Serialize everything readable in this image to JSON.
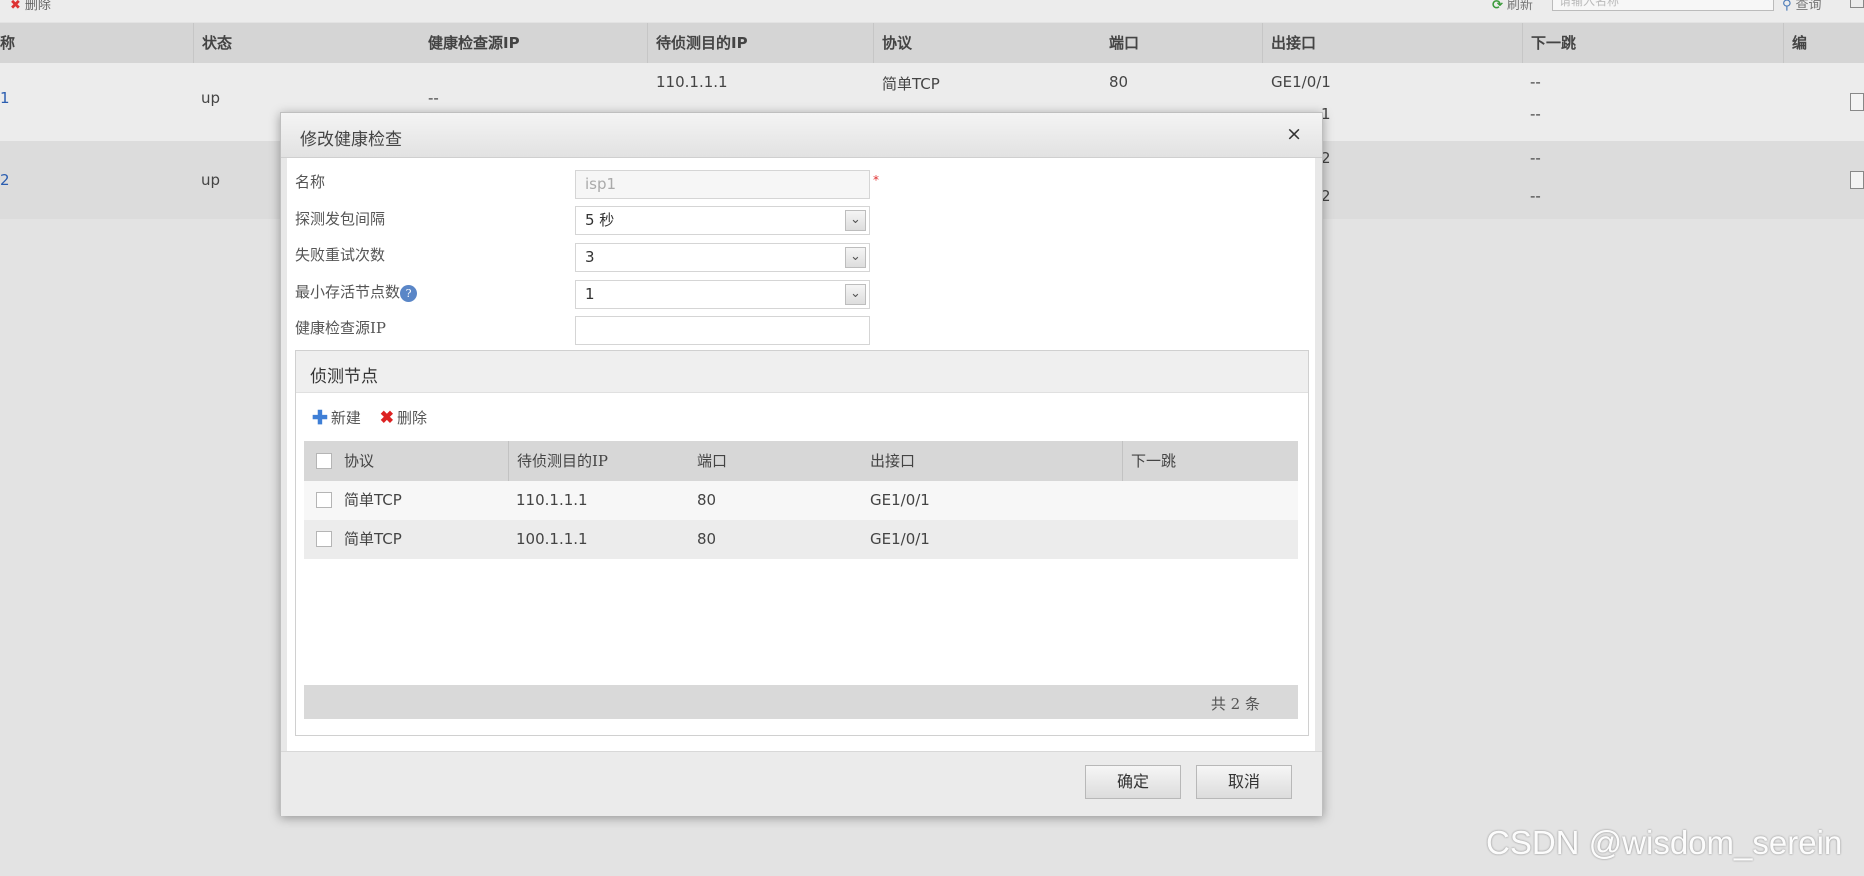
{
  "toolbar": {
    "delete_label": "删除",
    "refresh_label": "刷新",
    "search_placeholder": "请输入名称",
    "query_label": "查询"
  },
  "table": {
    "columns": [
      "称",
      "状态",
      "健康检查源IP",
      "待侦测目的IP",
      "协议",
      "端口",
      "出接口",
      "下一跳",
      "编"
    ],
    "rows": [
      {
        "name": "1",
        "status": "up",
        "source_ip": "--",
        "targets": [
          {
            "dest_ip": "110.1.1.1",
            "protocol": "简单TCP",
            "port": "80",
            "egress": "GE1/0/1",
            "next_hop": "--"
          },
          {
            "dest_ip": "",
            "protocol": "",
            "port": "",
            "egress": "1",
            "next_hop": "--"
          }
        ]
      },
      {
        "name": "2",
        "status": "up",
        "source_ip": "",
        "targets": [
          {
            "dest_ip": "",
            "protocol": "",
            "port": "",
            "egress": "2",
            "next_hop": "--"
          },
          {
            "dest_ip": "",
            "protocol": "",
            "port": "",
            "egress": "2",
            "next_hop": "--"
          }
        ]
      }
    ]
  },
  "dialog": {
    "title": "修改健康检查",
    "close_glyph": "×",
    "fields": {
      "name": {
        "label": "名称",
        "value": "isp1",
        "required_mark": "*"
      },
      "interval": {
        "label": "探测发包间隔",
        "value": "5 秒"
      },
      "retries": {
        "label": "失败重试次数",
        "value": "3"
      },
      "min_alive": {
        "label": "最小存活节点数",
        "value": "1",
        "help_glyph": "?"
      },
      "source_ip": {
        "label": "健康检查源IP",
        "value": ""
      }
    },
    "nodes_panel": {
      "title": "侦测节点",
      "new_label": "新建",
      "delete_label": "删除",
      "columns": [
        "协议",
        "待侦测目的IP",
        "端口",
        "出接口",
        "下一跳"
      ],
      "rows": [
        {
          "protocol": "简单TCP",
          "dest_ip": "110.1.1.1",
          "port": "80",
          "egress": "GE1/0/1",
          "next_hop": ""
        },
        {
          "protocol": "简单TCP",
          "dest_ip": "100.1.1.1",
          "port": "80",
          "egress": "GE1/0/1",
          "next_hop": ""
        }
      ],
      "total_label": "共 2 条"
    },
    "ok_label": "确定",
    "cancel_label": "取消"
  },
  "watermark": "CSDN @wisdom_serein",
  "colors": {
    "link": "#2a5db0",
    "required": "#e03030",
    "delete_icon": "#d22222",
    "add_icon": "#3f7fd6"
  }
}
